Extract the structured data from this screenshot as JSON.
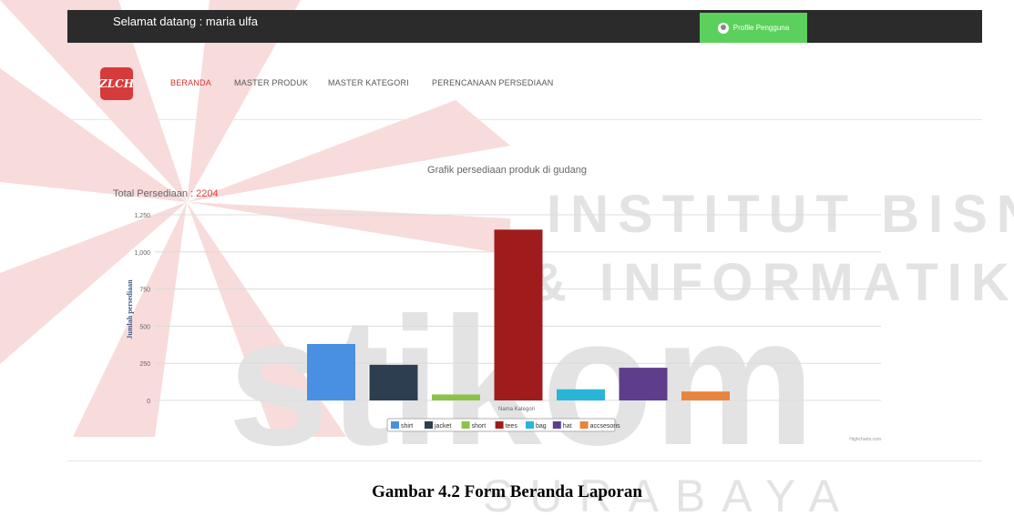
{
  "header": {
    "welcome_text": "Selamat datang : maria ulfa",
    "profile_button": "Profile Pengguna"
  },
  "logo_text": "ZLCH",
  "nav": {
    "items": [
      {
        "label": "BERANDA",
        "active": true
      },
      {
        "label": "MASTER PRODUK",
        "active": false
      },
      {
        "label": "MASTER KATEGORI",
        "active": false
      },
      {
        "label": "PERENCANAAN PERSEDIAAN",
        "active": false
      }
    ]
  },
  "summary": {
    "total_label": "Total Persediaan : ",
    "total_value": "2204"
  },
  "chart_data": {
    "type": "bar",
    "title": "Grafik persediaan produk di gudang",
    "xlabel": "Nama Kategori",
    "ylabel": "Jumlah persediaan",
    "ylim": [
      0,
      1250
    ],
    "yticks": [
      "0",
      "250",
      "500",
      "750",
      "1,000",
      "1,250"
    ],
    "grid": true,
    "legend_position": "bottom",
    "credits": "Highcharts.com",
    "series": [
      {
        "name": "shirt",
        "value": 380,
        "color": "#4a90e2"
      },
      {
        "name": "jacket",
        "value": 240,
        "color": "#2c3e50"
      },
      {
        "name": "short",
        "value": 40,
        "color": "#8bc34a"
      },
      {
        "name": "tees",
        "value": 1150,
        "color": "#a01c1c"
      },
      {
        "name": "bag",
        "value": 75,
        "color": "#29b6d6"
      },
      {
        "name": "hat",
        "value": 220,
        "color": "#5e3d8c"
      },
      {
        "name": "accsesoris",
        "value": 60,
        "color": "#e8843c"
      }
    ]
  },
  "watermark": {
    "line1": "INSTITUT BISNIS",
    "line2": "& INFORMATIKA",
    "brand": "stikom",
    "city": "SURABAYA"
  },
  "caption": "Gambar 4.2 Form Beranda Laporan"
}
